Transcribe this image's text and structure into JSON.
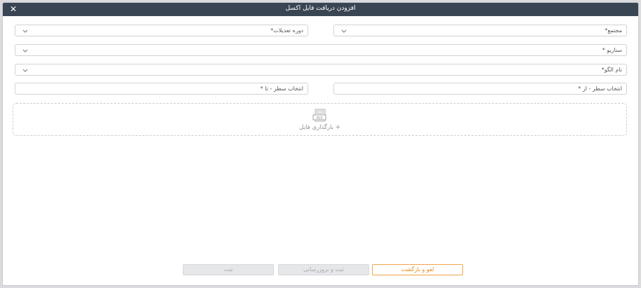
{
  "dialog": {
    "title": "افزودن دریافت فایل اکسل",
    "close_icon": "close-icon"
  },
  "fields": {
    "complex_label": "مجتمع*",
    "adjustment_period_label": "دوره تعدیلات*",
    "scenario_label": "سناریو *",
    "template_name_label": "نام الگو*",
    "row_from_label": "انتخاب سطر - از *",
    "row_to_label": "انتخاب سطر - تا *"
  },
  "upload": {
    "label": "+ بارگذاری فایل",
    "icon": "xls-file-icon"
  },
  "buttons": {
    "cancel_back": "لغو و بازگشت",
    "save_update": "ثبت و بروزرسانی",
    "save": "ثبت"
  },
  "colors": {
    "titlebar": "#3a4554",
    "accent": "#f0a54a",
    "disabled": "#e6e7e9"
  }
}
